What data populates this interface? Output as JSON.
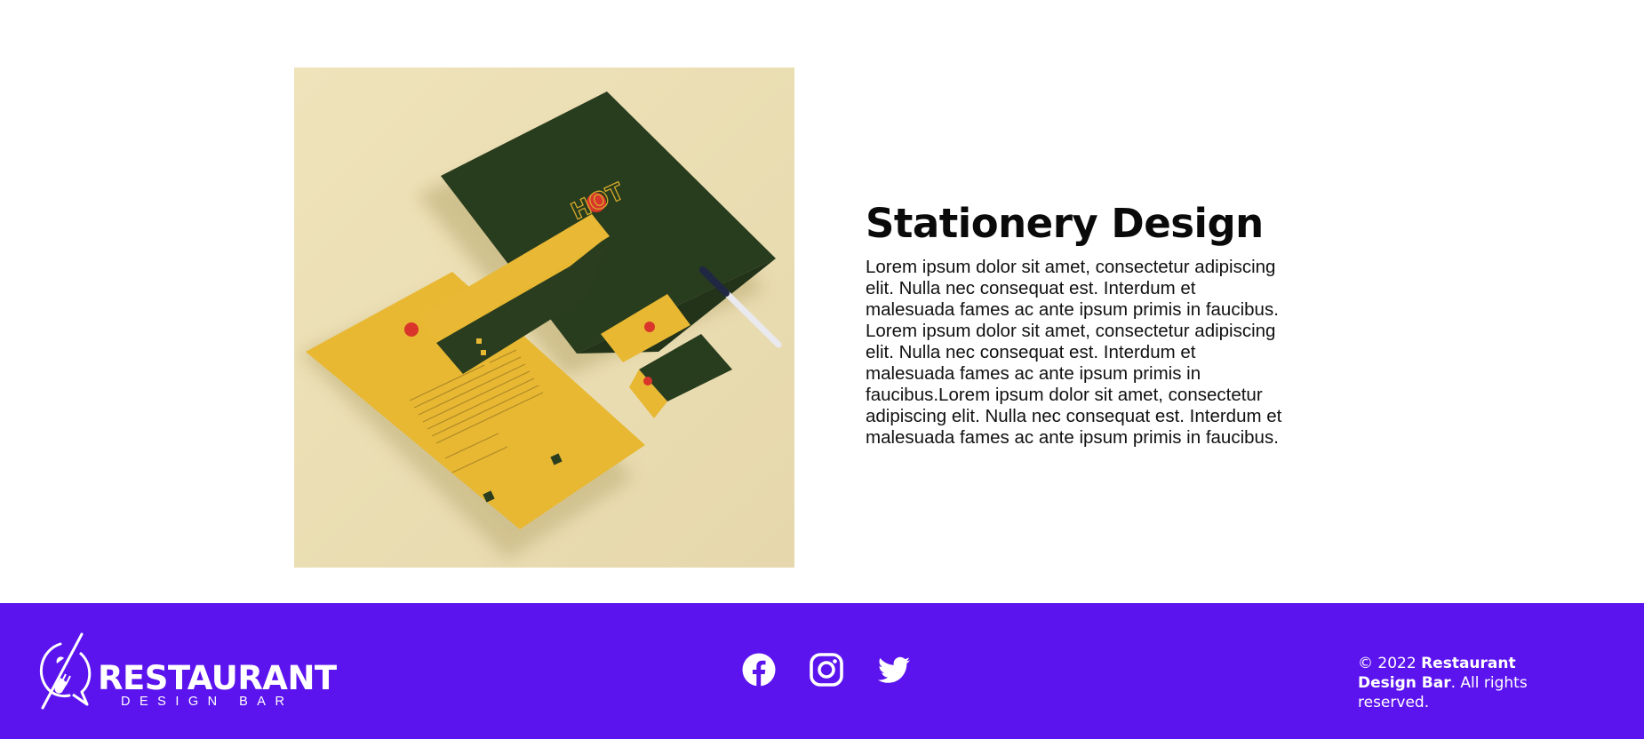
{
  "section": {
    "title": "Stationery Design",
    "body": "Lorem ipsum dolor sit amet, consectetur adipiscing elit. Nulla nec consequat est. Interdum et malesuada fames ac ante ipsum primis in faucibus. Lorem ipsum dolor sit amet, consectetur adipiscing elit. Nulla nec consequat est. Interdum et malesuada fames ac ante ipsum primis in faucibus.Lorem ipsum dolor sit amet, consectetur adipiscing elit. Nulla nec consequat est. Interdum et malesuada fames ac ante ipsum primis in faucibus.",
    "image_icon": "stationery-mockup-image"
  },
  "footer": {
    "logo_word": "RESTAURANT",
    "logo_sub": "DESIGN BAR",
    "socials": [
      {
        "icon": "facebook-icon"
      },
      {
        "icon": "instagram-icon"
      },
      {
        "icon": "twitter-icon"
      }
    ],
    "copyright_prefix": "© 2022 ",
    "copyright_brand": "Restaurant Design Bar",
    "copyright_suffix": ". All rights reserved."
  },
  "colors": {
    "footer_bg": "#5c14ee",
    "mockup_bg": "#ebdfb4",
    "paper_yellow": "#e8b833",
    "paper_green": "#2a3d1f"
  }
}
